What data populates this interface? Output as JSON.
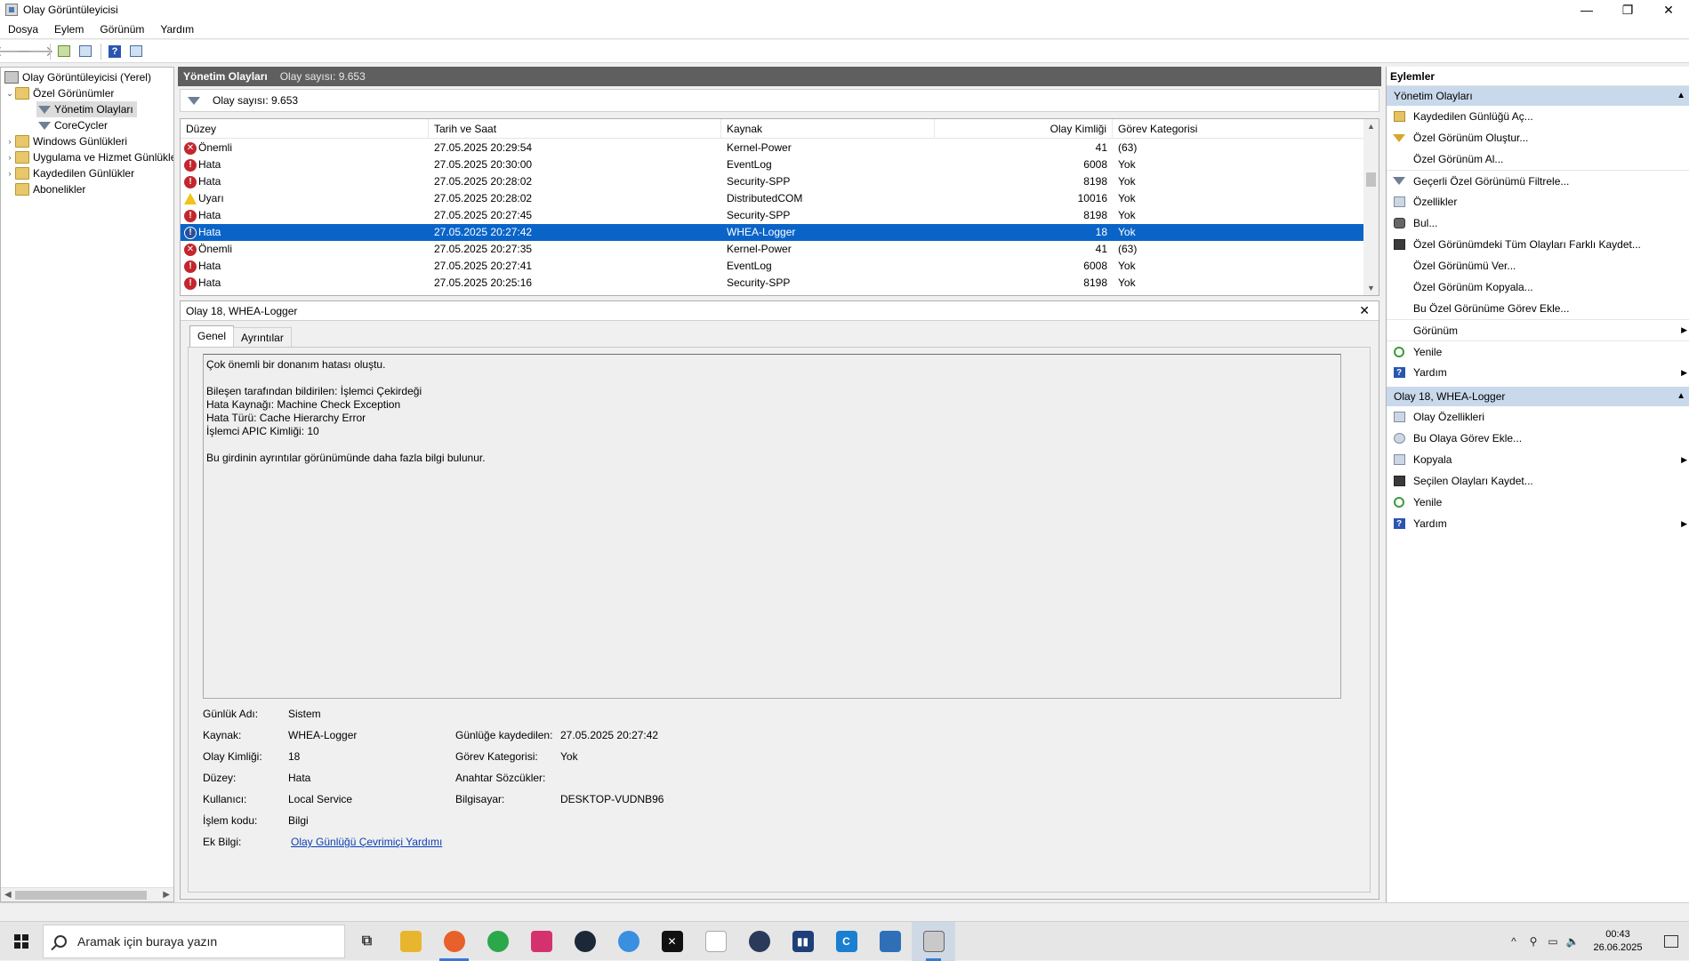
{
  "window": {
    "title": "Olay Görüntüleyicisi",
    "minimize": "—",
    "maximize": "❐",
    "close": "✕"
  },
  "menu": [
    "Dosya",
    "Eylem",
    "Görünüm",
    "Yardım"
  ],
  "tree": {
    "root": "Olay Görüntüleyicisi (Yerel)",
    "custom_views": "Özel Görünümler",
    "admin_events": "Yönetim Olayları",
    "corecycler": "CoreCycler",
    "windows_logs": "Windows Günlükleri",
    "app_service_logs": "Uygulama ve Hizmet Günlükleri",
    "saved_logs": "Kaydedilen Günlükler",
    "subscriptions": "Abonelikler"
  },
  "center": {
    "title": "Yönetim Olayları",
    "count": "Olay sayısı: 9.653",
    "filter_count": "Olay sayısı: 9.653",
    "columns": [
      "Düzey",
      "Tarih ve Saat",
      "Kaynak",
      "Olay Kimliği",
      "Görev Kategorisi"
    ],
    "rows": [
      {
        "level": "Önemli",
        "icon": "critical",
        "date": "27.05.2025 20:29:54",
        "source": "Kernel-Power",
        "id": "41",
        "category": "(63)"
      },
      {
        "level": "Hata",
        "icon": "error",
        "date": "27.05.2025 20:30:00",
        "source": "EventLog",
        "id": "6008",
        "category": "Yok"
      },
      {
        "level": "Hata",
        "icon": "error",
        "date": "27.05.2025 20:28:02",
        "source": "Security-SPP",
        "id": "8198",
        "category": "Yok"
      },
      {
        "level": "Uyarı",
        "icon": "warning",
        "date": "27.05.2025 20:28:02",
        "source": "DistributedCOM",
        "id": "10016",
        "category": "Yok"
      },
      {
        "level": "Hata",
        "icon": "error",
        "date": "27.05.2025 20:27:45",
        "source": "Security-SPP",
        "id": "8198",
        "category": "Yok"
      },
      {
        "level": "Hata",
        "icon": "error",
        "date": "27.05.2025 20:27:42",
        "source": "WHEA-Logger",
        "id": "18",
        "category": "Yok",
        "selected": true
      },
      {
        "level": "Önemli",
        "icon": "critical",
        "date": "27.05.2025 20:27:35",
        "source": "Kernel-Power",
        "id": "41",
        "category": "(63)"
      },
      {
        "level": "Hata",
        "icon": "error",
        "date": "27.05.2025 20:27:41",
        "source": "EventLog",
        "id": "6008",
        "category": "Yok"
      },
      {
        "level": "Hata",
        "icon": "error",
        "date": "27.05.2025 20:25:16",
        "source": "Security-SPP",
        "id": "8198",
        "category": "Yok"
      }
    ]
  },
  "detail": {
    "title": "Olay 18, WHEA-Logger",
    "tab_general": "Genel",
    "tab_details": "Ayrıntılar",
    "description": "Çok önemli bir donanım hatası oluştu.\n\nBileşen tarafından bildirilen: İşlemci Çekirdeği\nHata Kaynağı: Machine Check Exception\nHata Türü: Cache Hierarchy Error\nİşlemci APIC Kimliği: 10\n\nBu girdinin ayrıntılar görünümünde daha fazla bilgi bulunur.",
    "labels": {
      "log_name": "Günlük Adı:",
      "source": "Kaynak:",
      "event_id": "Olay Kimliği:",
      "level": "Düzey:",
      "user": "Kullanıcı:",
      "opcode": "İşlem kodu:",
      "more_info": "Ek Bilgi:",
      "logged": "Günlüğe kaydedilen:",
      "task_category": "Görev Kategorisi:",
      "keywords": "Anahtar Sözcükler:",
      "computer": "Bilgisayar:"
    },
    "values": {
      "log_name": "Sistem",
      "source": "WHEA-Logger",
      "event_id": "18",
      "level": "Hata",
      "user": "Local Service",
      "opcode": "Bilgi",
      "more_info_link": "Olay Günlüğü Çevrimiçi Yardımı",
      "logged": "27.05.2025 20:27:42",
      "task_category": "Yok",
      "keywords": "",
      "computer": "DESKTOP-VUDNB96"
    }
  },
  "actions": {
    "header": "Eylemler",
    "section1": "Yönetim Olayları",
    "items1": [
      {
        "label": "Kaydedilen Günlüğü Aç...",
        "icon": "open-log-icon"
      },
      {
        "label": "Özel Görünüm Oluştur...",
        "icon": "create-view-icon"
      },
      {
        "label": "Özel Görünüm Al...",
        "icon": ""
      },
      {
        "label": "Geçerli Özel Görünümü Filtrele...",
        "icon": "filter-icon"
      },
      {
        "label": "Özellikler",
        "icon": "properties-icon"
      },
      {
        "label": "Bul...",
        "icon": "find-icon"
      },
      {
        "label": "Özel Görünümdeki Tüm Olayları Farklı Kaydet...",
        "icon": "save-icon"
      },
      {
        "label": "Özel Görünümü Ver...",
        "icon": ""
      },
      {
        "label": "Özel Görünüm Kopyala...",
        "icon": ""
      },
      {
        "label": "Bu Özel Görünüme Görev Ekle...",
        "icon": ""
      },
      {
        "label": "Görünüm",
        "icon": ""
      },
      {
        "label": "Yenile",
        "icon": "refresh-icon"
      },
      {
        "label": "Yardım",
        "icon": "help-icon"
      }
    ],
    "section2": "Olay 18, WHEA-Logger",
    "items2": [
      {
        "label": "Olay Özellikleri",
        "icon": "event-properties-icon"
      },
      {
        "label": "Bu Olaya Görev Ekle...",
        "icon": "task-icon"
      },
      {
        "label": "Kopyala",
        "icon": "copy-icon"
      },
      {
        "label": "Seçilen Olayları Kaydet...",
        "icon": "save-icon"
      },
      {
        "label": "Yenile",
        "icon": "refresh-icon"
      },
      {
        "label": "Yardım",
        "icon": "help-icon"
      }
    ]
  },
  "taskbar": {
    "search_placeholder": "Aramak için buraya yazın",
    "time": "00:43",
    "date": "26.06.2025",
    "apps": [
      "task-view",
      "file-explorer",
      "firefox",
      "whatsapp",
      "instagram",
      "steam",
      "app-blue",
      "capcut",
      "notepad",
      "app-dark",
      "bar-app",
      "c-app",
      "remote-desktop",
      "event-viewer"
    ]
  }
}
